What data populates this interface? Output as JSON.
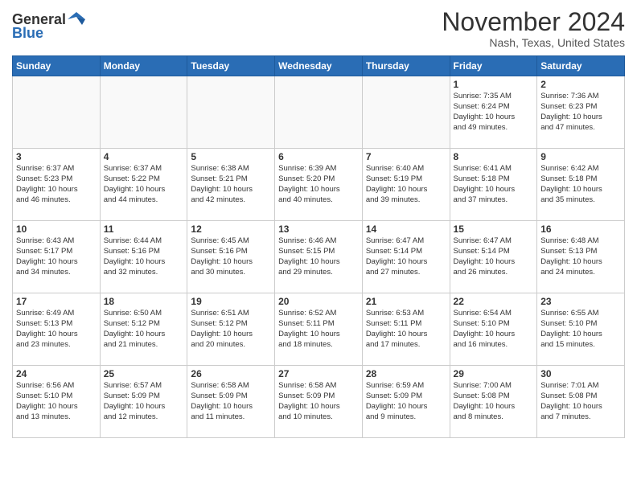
{
  "header": {
    "logo_general": "General",
    "logo_blue": "Blue",
    "month_title": "November 2024",
    "location": "Nash, Texas, United States"
  },
  "weekdays": [
    "Sunday",
    "Monday",
    "Tuesday",
    "Wednesday",
    "Thursday",
    "Friday",
    "Saturday"
  ],
  "weeks": [
    [
      {
        "day": null,
        "info": null
      },
      {
        "day": null,
        "info": null
      },
      {
        "day": null,
        "info": null
      },
      {
        "day": null,
        "info": null
      },
      {
        "day": null,
        "info": null
      },
      {
        "day": "1",
        "info": "Sunrise: 7:35 AM\nSunset: 6:24 PM\nDaylight: 10 hours\nand 49 minutes."
      },
      {
        "day": "2",
        "info": "Sunrise: 7:36 AM\nSunset: 6:23 PM\nDaylight: 10 hours\nand 47 minutes."
      }
    ],
    [
      {
        "day": "3",
        "info": "Sunrise: 6:37 AM\nSunset: 5:23 PM\nDaylight: 10 hours\nand 46 minutes."
      },
      {
        "day": "4",
        "info": "Sunrise: 6:37 AM\nSunset: 5:22 PM\nDaylight: 10 hours\nand 44 minutes."
      },
      {
        "day": "5",
        "info": "Sunrise: 6:38 AM\nSunset: 5:21 PM\nDaylight: 10 hours\nand 42 minutes."
      },
      {
        "day": "6",
        "info": "Sunrise: 6:39 AM\nSunset: 5:20 PM\nDaylight: 10 hours\nand 40 minutes."
      },
      {
        "day": "7",
        "info": "Sunrise: 6:40 AM\nSunset: 5:19 PM\nDaylight: 10 hours\nand 39 minutes."
      },
      {
        "day": "8",
        "info": "Sunrise: 6:41 AM\nSunset: 5:18 PM\nDaylight: 10 hours\nand 37 minutes."
      },
      {
        "day": "9",
        "info": "Sunrise: 6:42 AM\nSunset: 5:18 PM\nDaylight: 10 hours\nand 35 minutes."
      }
    ],
    [
      {
        "day": "10",
        "info": "Sunrise: 6:43 AM\nSunset: 5:17 PM\nDaylight: 10 hours\nand 34 minutes."
      },
      {
        "day": "11",
        "info": "Sunrise: 6:44 AM\nSunset: 5:16 PM\nDaylight: 10 hours\nand 32 minutes."
      },
      {
        "day": "12",
        "info": "Sunrise: 6:45 AM\nSunset: 5:16 PM\nDaylight: 10 hours\nand 30 minutes."
      },
      {
        "day": "13",
        "info": "Sunrise: 6:46 AM\nSunset: 5:15 PM\nDaylight: 10 hours\nand 29 minutes."
      },
      {
        "day": "14",
        "info": "Sunrise: 6:47 AM\nSunset: 5:14 PM\nDaylight: 10 hours\nand 27 minutes."
      },
      {
        "day": "15",
        "info": "Sunrise: 6:47 AM\nSunset: 5:14 PM\nDaylight: 10 hours\nand 26 minutes."
      },
      {
        "day": "16",
        "info": "Sunrise: 6:48 AM\nSunset: 5:13 PM\nDaylight: 10 hours\nand 24 minutes."
      }
    ],
    [
      {
        "day": "17",
        "info": "Sunrise: 6:49 AM\nSunset: 5:13 PM\nDaylight: 10 hours\nand 23 minutes."
      },
      {
        "day": "18",
        "info": "Sunrise: 6:50 AM\nSunset: 5:12 PM\nDaylight: 10 hours\nand 21 minutes."
      },
      {
        "day": "19",
        "info": "Sunrise: 6:51 AM\nSunset: 5:12 PM\nDaylight: 10 hours\nand 20 minutes."
      },
      {
        "day": "20",
        "info": "Sunrise: 6:52 AM\nSunset: 5:11 PM\nDaylight: 10 hours\nand 18 minutes."
      },
      {
        "day": "21",
        "info": "Sunrise: 6:53 AM\nSunset: 5:11 PM\nDaylight: 10 hours\nand 17 minutes."
      },
      {
        "day": "22",
        "info": "Sunrise: 6:54 AM\nSunset: 5:10 PM\nDaylight: 10 hours\nand 16 minutes."
      },
      {
        "day": "23",
        "info": "Sunrise: 6:55 AM\nSunset: 5:10 PM\nDaylight: 10 hours\nand 15 minutes."
      }
    ],
    [
      {
        "day": "24",
        "info": "Sunrise: 6:56 AM\nSunset: 5:10 PM\nDaylight: 10 hours\nand 13 minutes."
      },
      {
        "day": "25",
        "info": "Sunrise: 6:57 AM\nSunset: 5:09 PM\nDaylight: 10 hours\nand 12 minutes."
      },
      {
        "day": "26",
        "info": "Sunrise: 6:58 AM\nSunset: 5:09 PM\nDaylight: 10 hours\nand 11 minutes."
      },
      {
        "day": "27",
        "info": "Sunrise: 6:58 AM\nSunset: 5:09 PM\nDaylight: 10 hours\nand 10 minutes."
      },
      {
        "day": "28",
        "info": "Sunrise: 6:59 AM\nSunset: 5:09 PM\nDaylight: 10 hours\nand 9 minutes."
      },
      {
        "day": "29",
        "info": "Sunrise: 7:00 AM\nSunset: 5:08 PM\nDaylight: 10 hours\nand 8 minutes."
      },
      {
        "day": "30",
        "info": "Sunrise: 7:01 AM\nSunset: 5:08 PM\nDaylight: 10 hours\nand 7 minutes."
      }
    ]
  ]
}
